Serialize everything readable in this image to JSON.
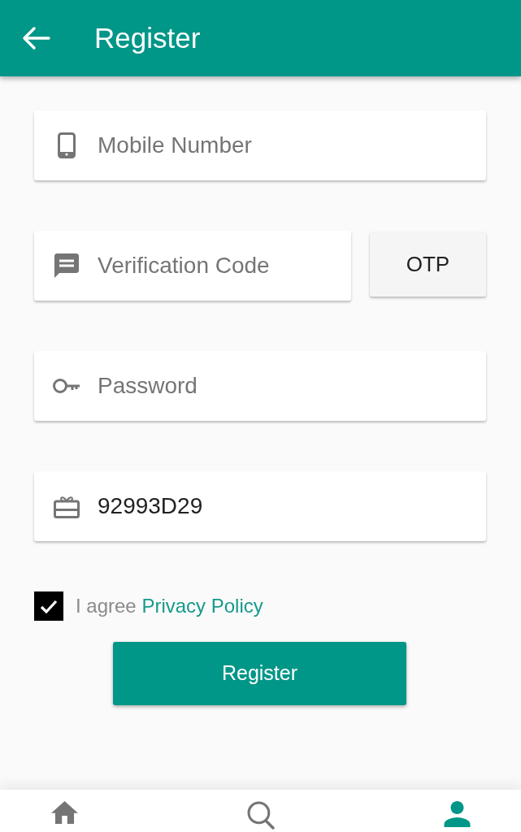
{
  "app_bar": {
    "title": "Register"
  },
  "fields": [
    {
      "kind": "input",
      "placeholder": "Mobile Number"
    },
    {
      "kind": "input_with_button",
      "placeholder": "Verification Code",
      "button": "OTP"
    },
    {
      "kind": "input",
      "placeholder": "Password"
    },
    {
      "kind": "input",
      "value": "92993D29"
    }
  ],
  "agreement": {
    "checked": true,
    "text": "I agree",
    "link": "Privacy Policy"
  },
  "submit_button": {
    "label": "Register"
  },
  "bottom_nav": {
    "items": [
      {
        "selected": false
      },
      {
        "selected": false
      },
      {
        "selected": true
      }
    ]
  }
}
